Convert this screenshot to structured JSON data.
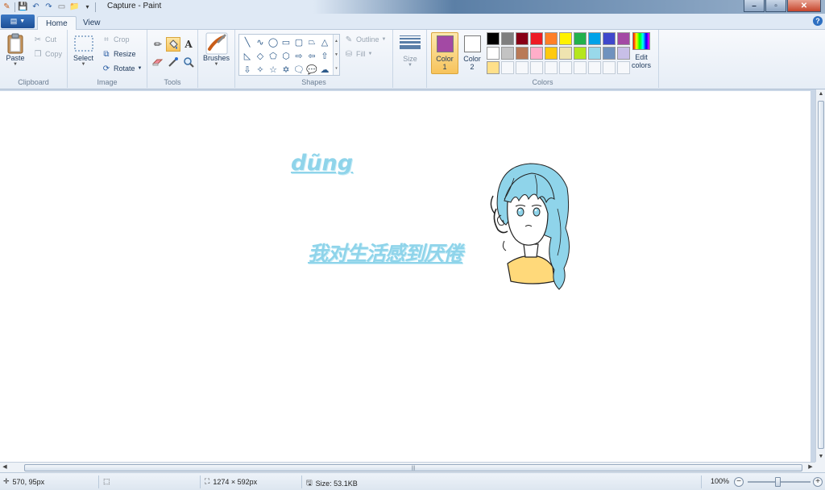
{
  "window": {
    "title": "Capture - Paint"
  },
  "tabs": [
    {
      "label": "Home"
    },
    {
      "label": "View"
    }
  ],
  "clipboard": {
    "paste_label": "Paste",
    "cut_label": "Cut",
    "copy_label": "Copy",
    "group_label": "Clipboard"
  },
  "image": {
    "select_label": "Select",
    "crop_label": "Crop",
    "resize_label": "Resize",
    "rotate_label": "Rotate",
    "group_label": "Image"
  },
  "tools": {
    "group_label": "Tools",
    "active_tool": "fill"
  },
  "brushes": {
    "label": "Brushes"
  },
  "shapes": {
    "outline_label": "Outline",
    "fill_label": "Fill",
    "group_label": "Shapes"
  },
  "size": {
    "label": "Size"
  },
  "colors": {
    "color1_label_a": "Color",
    "color1_label_b": "1",
    "color2_label_a": "Color",
    "color2_label_b": "2",
    "color1_value": "#a349a4",
    "color2_value": "#ffffff",
    "edit_label_a": "Edit",
    "edit_label_b": "colors",
    "group_label": "Colors",
    "palette_row1": [
      "#000000",
      "#7f7f7f",
      "#880015",
      "#ed1c24",
      "#ff7f27",
      "#fff200",
      "#22b14c",
      "#00a2e8",
      "#3f48cc",
      "#a349a4"
    ],
    "palette_row2": [
      "#ffffff",
      "#c3c3c3",
      "#b97a57",
      "#ffaec9",
      "#ffc90e",
      "#efe4b0",
      "#b5e61d",
      "#99d9ea",
      "#7092be",
      "#c8bfe7"
    ],
    "palette_row3": [
      "#ffe08a",
      "",
      "",
      "",
      "",
      "",
      "",
      "",
      "",
      ""
    ]
  },
  "canvas": {
    "text_pinyin": "dũng",
    "text_chinese": "我对生活感到厌倦",
    "text_color": "#8fd4ea",
    "hair_color": "#8fd4ea",
    "skin_color": "#ffd97a"
  },
  "status": {
    "cursor_pos": "570, 95px",
    "image_size": "1274 × 592px",
    "file_size": "Size: 53.1KB",
    "zoom": "100%"
  }
}
